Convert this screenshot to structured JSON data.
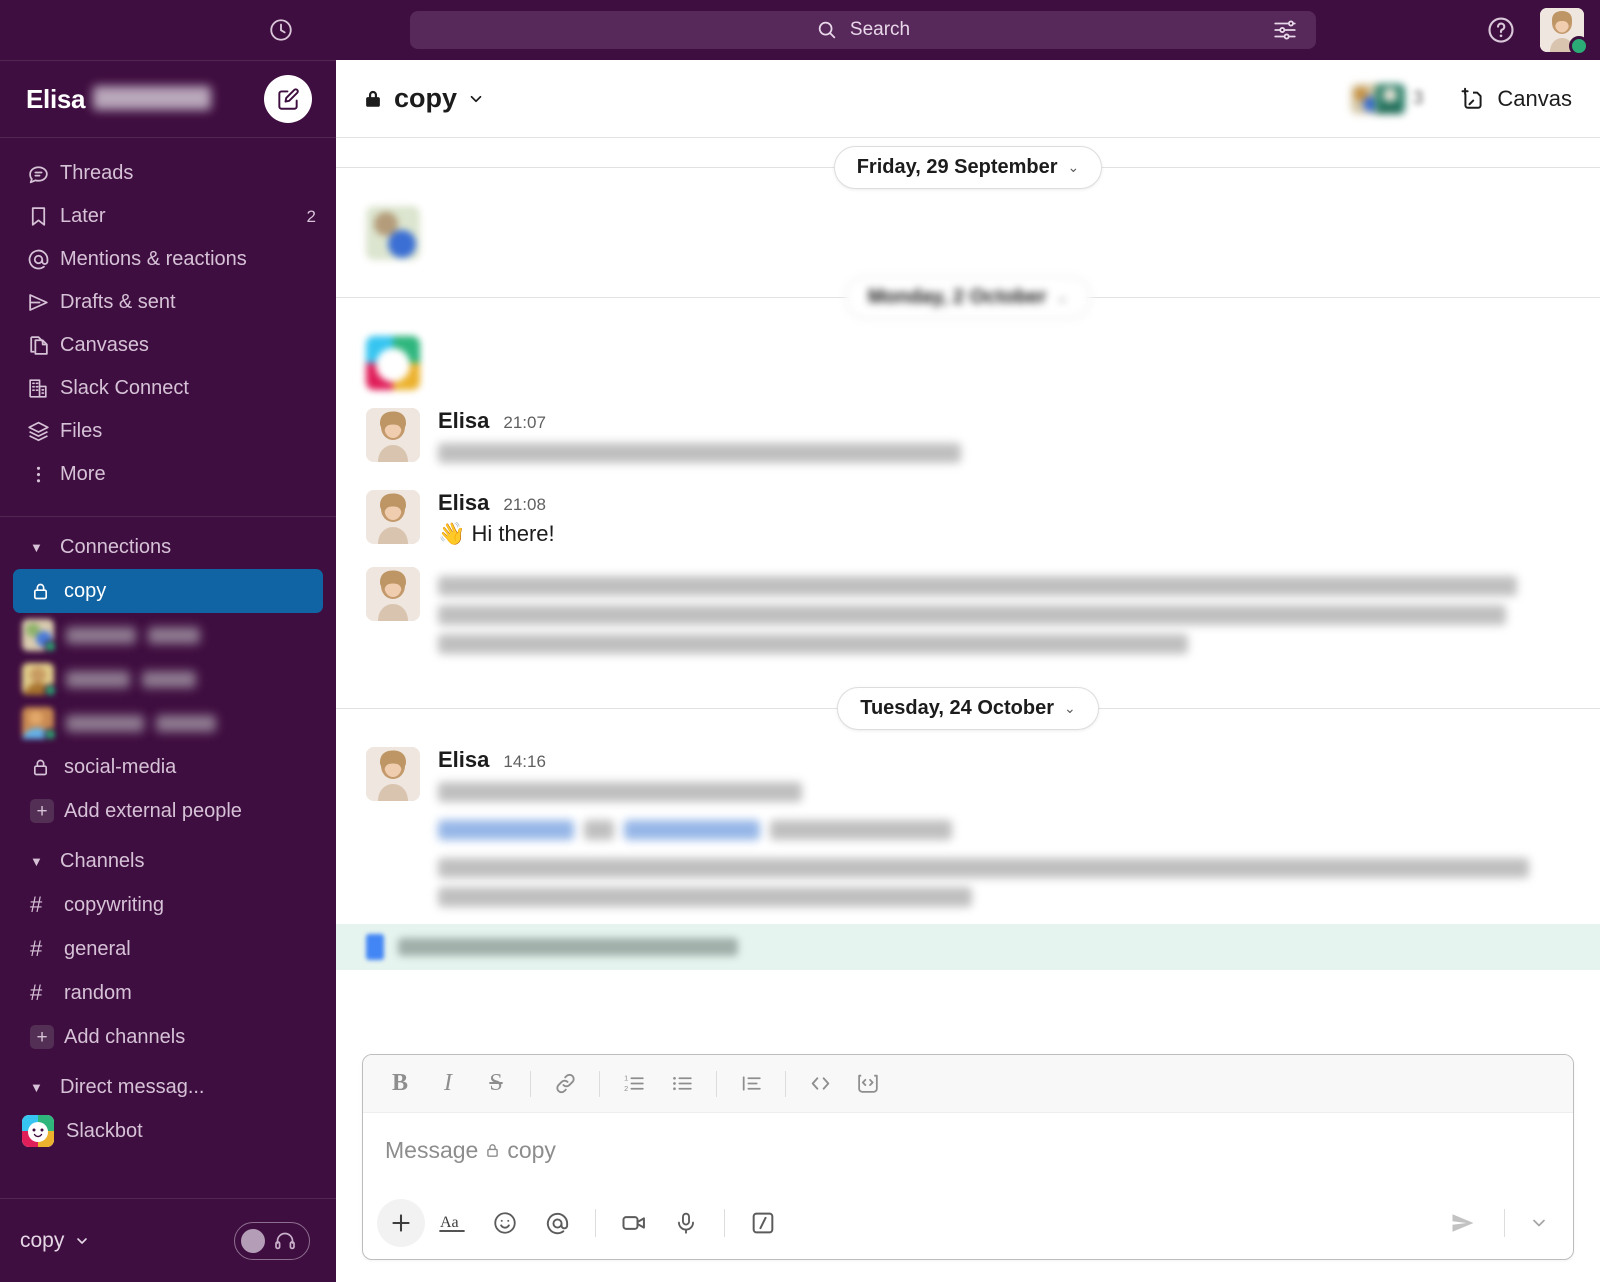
{
  "topbar": {
    "clock_icon": "clock-icon",
    "search_placeholder": "Search",
    "search_icon": "search-icon",
    "filter_icon": "filter-sliders-icon",
    "help_icon": "help-question-icon",
    "avatar_name": "avatar",
    "presence": "active"
  },
  "sidebar": {
    "workspace_name": "Elisa",
    "compose_label": "compose-new-message",
    "nav": [
      {
        "label": "Threads",
        "icon": "threads-icon",
        "badge": ""
      },
      {
        "label": "Later",
        "icon": "bookmark-icon",
        "badge": "2"
      },
      {
        "label": "Mentions & reactions",
        "icon": "at-icon",
        "badge": ""
      },
      {
        "label": "Drafts & sent",
        "icon": "paper-plane-icon",
        "badge": ""
      },
      {
        "label": "Canvases",
        "icon": "canvas-icon",
        "badge": ""
      },
      {
        "label": "Slack Connect",
        "icon": "building-icon",
        "badge": ""
      },
      {
        "label": "Files",
        "icon": "layers-icon",
        "badge": ""
      },
      {
        "label": "More",
        "icon": "more-vertical-icon",
        "badge": ""
      }
    ],
    "sections": {
      "connections": {
        "label": "Connections",
        "items": [
          {
            "label": "copy",
            "icon": "lock-icon",
            "active": true
          },
          {
            "label": "social-media",
            "icon": "lock-icon",
            "active": false
          },
          {
            "label": "Add external people",
            "icon": "plus-icon",
            "active": false
          }
        ]
      },
      "channels": {
        "label": "Channels",
        "items": [
          {
            "label": "copywriting",
            "icon": "hash-icon"
          },
          {
            "label": "general",
            "icon": "hash-icon"
          },
          {
            "label": "random",
            "icon": "hash-icon"
          },
          {
            "label": "Add channels",
            "icon": "plus-icon"
          }
        ]
      },
      "dms": {
        "label": "Direct messag...",
        "items": [
          {
            "label": "Slackbot",
            "icon": "slackbot-icon"
          }
        ]
      }
    },
    "footer": {
      "label": "copy",
      "caret_icon": "chevron-down-icon",
      "huddle_icon": "headphones-icon"
    }
  },
  "channel_header": {
    "name": "copy",
    "lock_icon": "lock-icon",
    "caret_icon": "chevron-down-icon",
    "member_count": "3",
    "canvas_label": "Canvas",
    "canvas_icon": "add-canvas-icon"
  },
  "messages": {
    "dividers": {
      "d1": "Friday, 29 September",
      "d2": "Monday, 2 October",
      "d3": "Tuesday, 24 October"
    },
    "items": [
      {
        "author": "",
        "time": "",
        "text": "",
        "blurred": true
      },
      {
        "author": "",
        "time": "",
        "text": "",
        "blurred": true
      },
      {
        "author": "Elisa",
        "time": "21:07",
        "text": "",
        "blurred": false,
        "body_blurred": true
      },
      {
        "author": "Elisa",
        "time": "21:08",
        "text": "👋 Hi there!",
        "blurred": false,
        "body_blurred": false
      },
      {
        "author": "",
        "time": "",
        "text": "",
        "blurred": true
      },
      {
        "author": "Elisa",
        "time": "14:16",
        "text": "",
        "blurred": false,
        "body_blurred": true
      }
    ],
    "external_banner": "external-people-notice"
  },
  "composer": {
    "placeholder_prefix": "Message",
    "placeholder_channel": "copy",
    "lock_icon": "lock-icon",
    "format_buttons": [
      {
        "name": "bold-button",
        "glyph": "B"
      },
      {
        "name": "italic-button",
        "glyph": "I"
      },
      {
        "name": "strikethrough-button",
        "glyph": "S"
      },
      {
        "name": "link-button",
        "glyph": ""
      },
      {
        "name": "ordered-list-button",
        "glyph": ""
      },
      {
        "name": "bulleted-list-button",
        "glyph": ""
      },
      {
        "name": "blockquote-button",
        "glyph": ""
      },
      {
        "name": "code-button",
        "glyph": ""
      },
      {
        "name": "code-block-button",
        "glyph": ""
      }
    ],
    "action_buttons": [
      {
        "name": "attach-plus-button"
      },
      {
        "name": "formatting-aa-button"
      },
      {
        "name": "emoji-button"
      },
      {
        "name": "mention-button"
      },
      {
        "name": "video-clip-button"
      },
      {
        "name": "audio-clip-button"
      },
      {
        "name": "slash-command-button"
      }
    ],
    "send_icon": "send-icon",
    "send_options_icon": "chevron-down-icon"
  },
  "colors": {
    "sidebar_bg": "#3F0E40",
    "active_channel": "#1164A3",
    "presence_green": "#2BAC76",
    "external_banner": "#E6F4EF"
  }
}
